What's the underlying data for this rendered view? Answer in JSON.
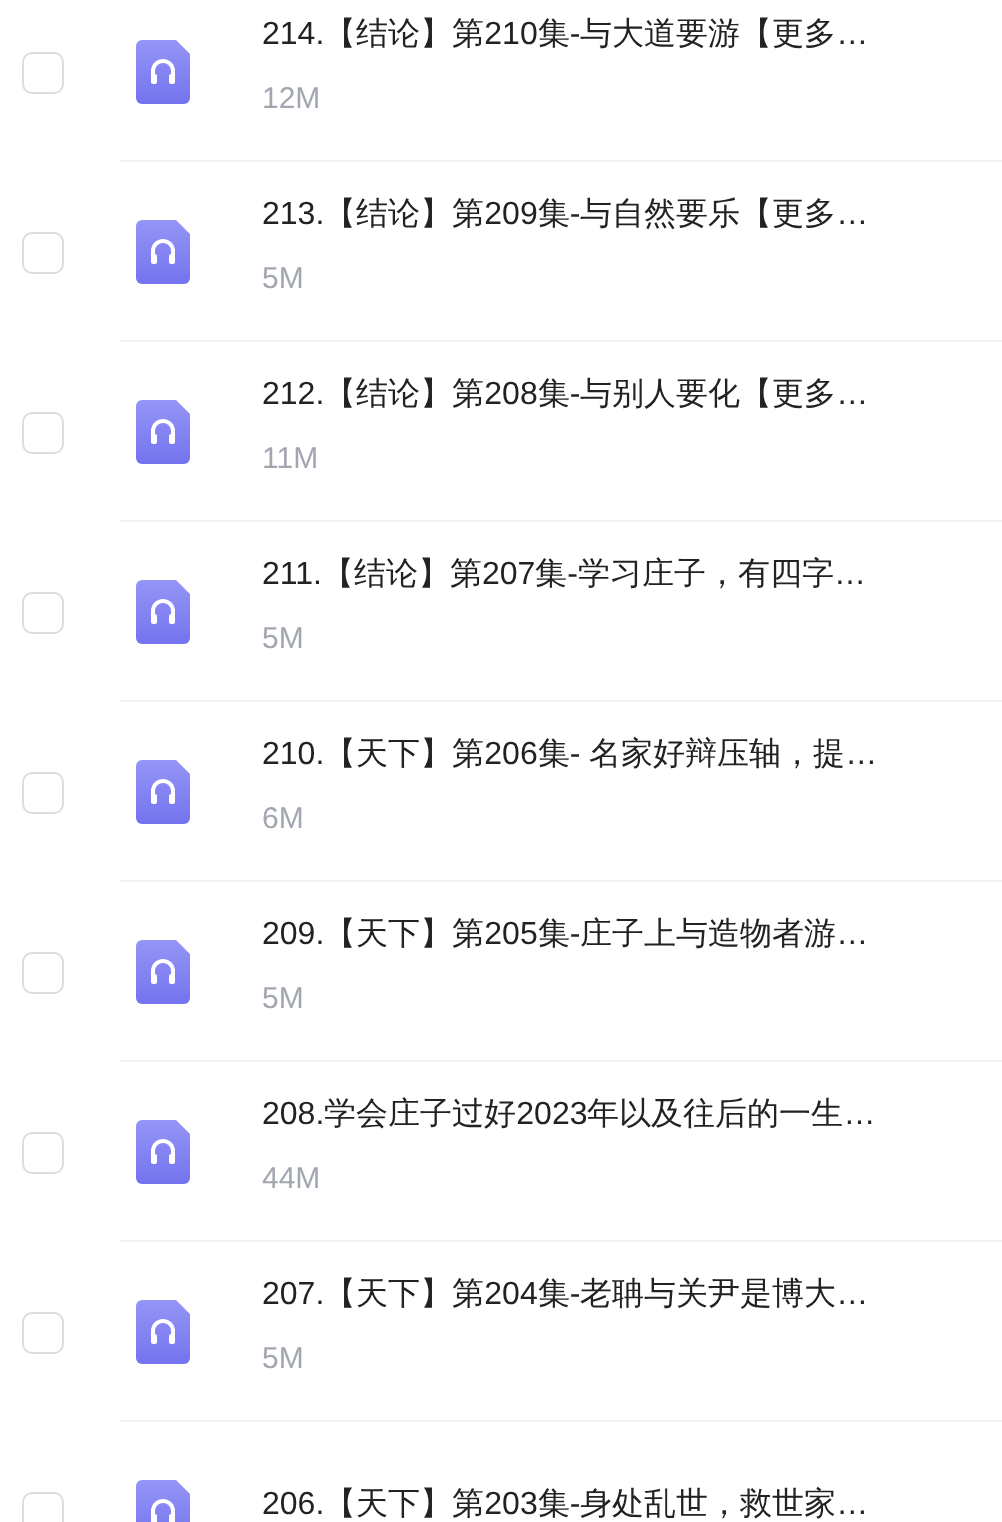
{
  "files": [
    {
      "title": "214.【结论】第210集-与大道要游【更多…",
      "size": "12M",
      "checked": false
    },
    {
      "title": "213.【结论】第209集-与自然要乐【更多…",
      "size": "5M",
      "checked": false
    },
    {
      "title": "212.【结论】第208集-与别人要化【更多…",
      "size": "11M",
      "checked": false
    },
    {
      "title": "211.【结论】第207集-学习庄子，有四字…",
      "size": "5M",
      "checked": false
    },
    {
      "title": "210.【天下】第206集- 名家好辩压轴，提…",
      "size": "6M",
      "checked": false
    },
    {
      "title": "209.【天下】第205集-庄子上与造物者游…",
      "size": "5M",
      "checked": false
    },
    {
      "title": "208.学会庄子过好2023年以及往后的一生…",
      "size": "44M",
      "checked": false
    },
    {
      "title": "207.【天下】第204集-老聃与关尹是博大…",
      "size": "5M",
      "checked": false
    },
    {
      "title": "206.【天下】第203集-身处乱世，救世家…",
      "checked": false
    }
  ]
}
